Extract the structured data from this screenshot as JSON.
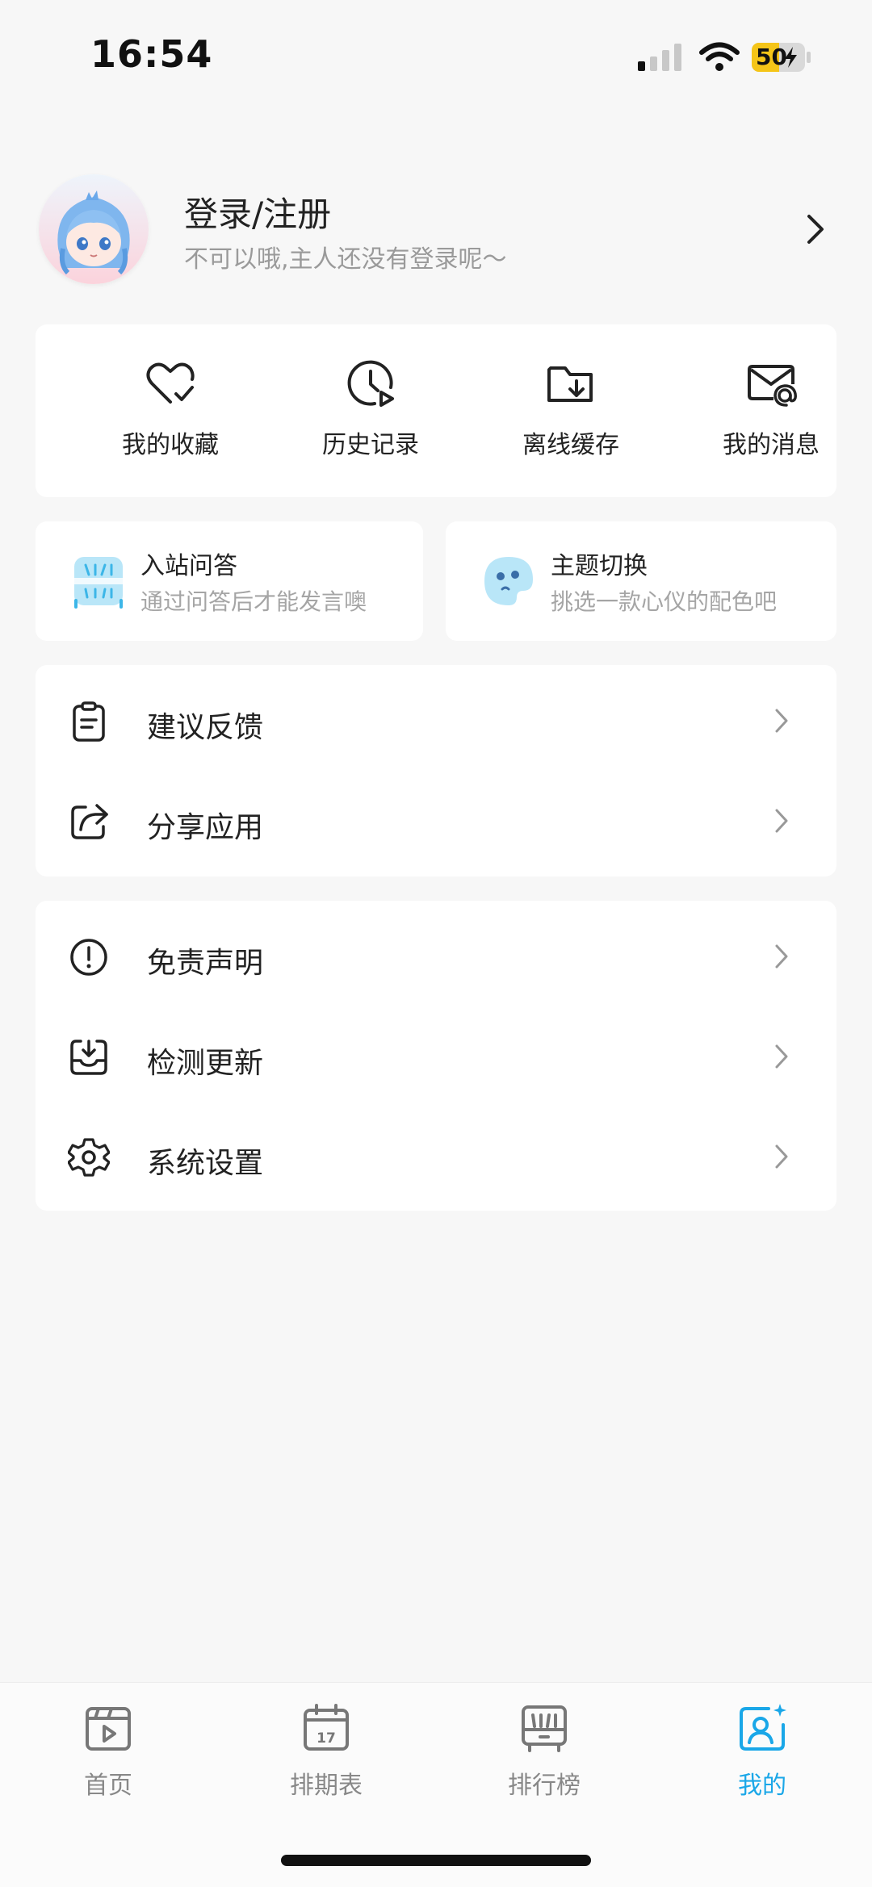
{
  "status_bar": {
    "time": "16:54",
    "battery": "50"
  },
  "profile": {
    "title": "登录/注册",
    "subtitle": "不可以哦,主人还没有登录呢～"
  },
  "quick_actions": [
    {
      "label": "我的收藏",
      "icon": "heart-check-icon"
    },
    {
      "label": "历史记录",
      "icon": "clock-play-icon"
    },
    {
      "label": "离线缓存",
      "icon": "folder-download-icon"
    },
    {
      "label": "我的消息",
      "icon": "mail-at-icon"
    }
  ],
  "promos": [
    {
      "title": "入站问答",
      "subtitle": "通过问答后才能发言噢",
      "icon": "quiz-icon"
    },
    {
      "title": "主题切换",
      "subtitle": "挑选一款心仪的配色吧",
      "icon": "palette-icon"
    }
  ],
  "menu_group_1": [
    {
      "label": "建议反馈",
      "icon": "clipboard-icon"
    },
    {
      "label": "分享应用",
      "icon": "share-icon"
    }
  ],
  "menu_group_2": [
    {
      "label": "免责声明",
      "icon": "alert-circle-icon"
    },
    {
      "label": "检测更新",
      "icon": "inbox-download-icon"
    },
    {
      "label": "系统设置",
      "icon": "gear-icon"
    }
  ],
  "tabs": [
    {
      "label": "首页",
      "icon": "home-play-icon",
      "active": false
    },
    {
      "label": "排期表",
      "icon": "calendar-icon",
      "active": false
    },
    {
      "label": "排行榜",
      "icon": "ranking-icon",
      "active": false
    },
    {
      "label": "我的",
      "icon": "profile-icon",
      "active": true
    }
  ],
  "colors": {
    "accent": "#1aa7e8",
    "background": "#f7f7f7",
    "battery": "#f5c518"
  },
  "calendar_day": "17"
}
